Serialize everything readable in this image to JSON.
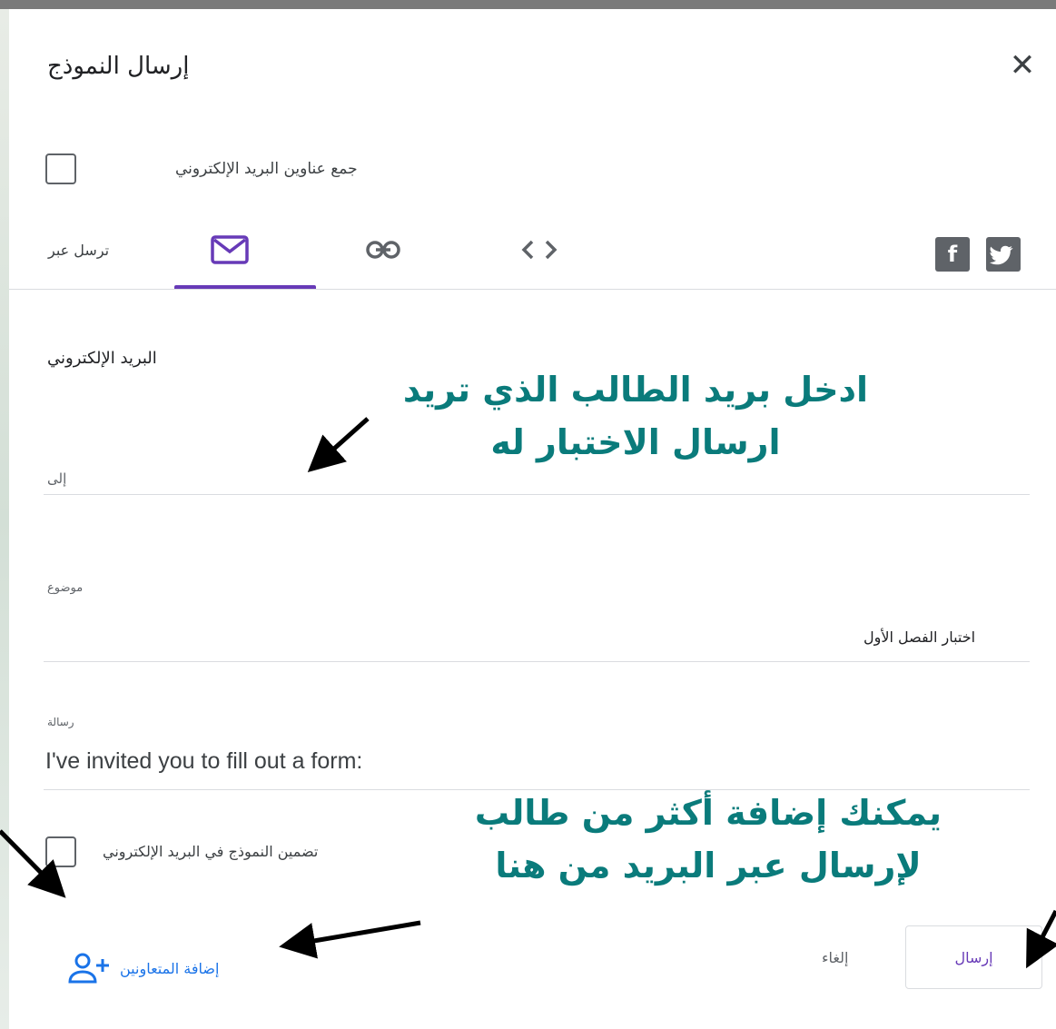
{
  "dialog": {
    "title": "إرسال النموذج",
    "collect_emails_label": "جمع عناوين البريد الإلكتروني",
    "send_via_label": "ترسل عبر",
    "section_title": "البريد الإلكتروني",
    "to": {
      "label": "إلى",
      "value": ""
    },
    "subject": {
      "label": "موضوع",
      "value": "اختبار الفصل الأول"
    },
    "message": {
      "label": "رسالة",
      "value": "I've invited you to fill out a form:"
    },
    "include_form_label": "تضمين النموذج في البريد الإلكتروني",
    "add_collaborators_label": "إضافة المتعاونين",
    "cancel_label": "إلغاء",
    "send_label": "إرسال",
    "social_facebook": "f"
  },
  "annotations": {
    "to_hint_line1": "ادخل بريد الطالب الذي تريد",
    "to_hint_line2": "ارسال الاختبار له",
    "collab_hint_line1": "يمكنك إضافة أكثر من طالب",
    "collab_hint_line2": "لإرسال عبر البريد من هنا"
  },
  "colors": {
    "accent": "#673ab7",
    "annotation": "#0a7b7b",
    "link": "#1a73e8"
  },
  "icons": [
    "close-icon",
    "mail-icon",
    "link-icon",
    "code-icon",
    "facebook-icon",
    "twitter-icon",
    "add-person-icon",
    "arrow-icon"
  ]
}
